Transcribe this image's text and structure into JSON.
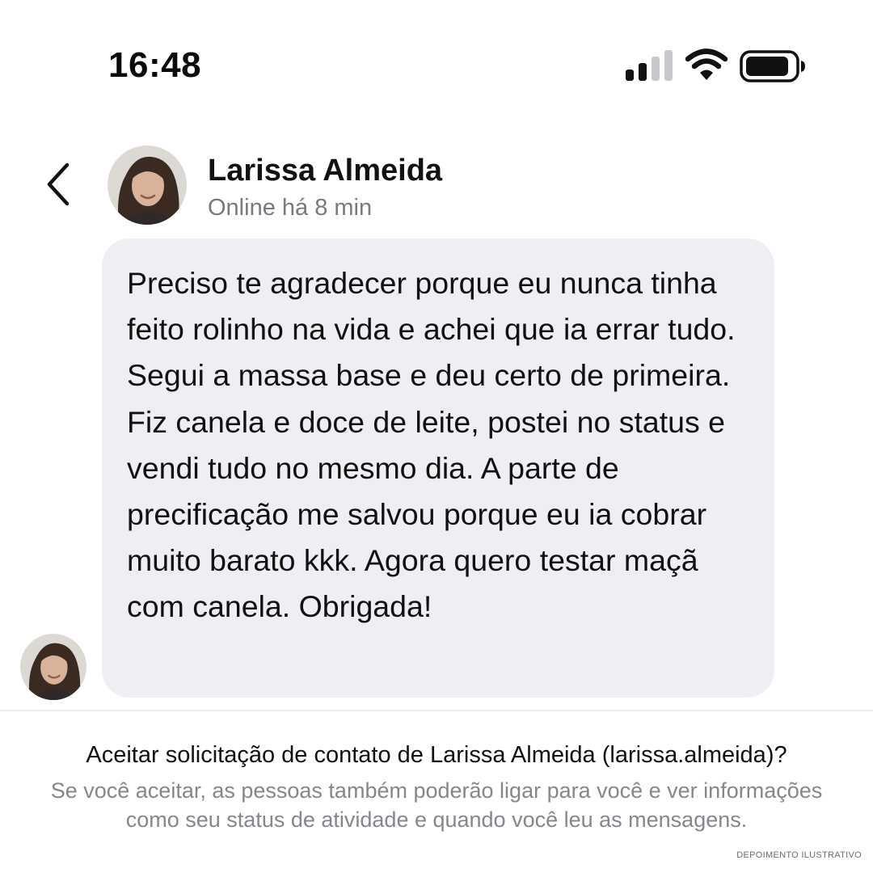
{
  "status_bar": {
    "time": "16:48",
    "signal_icon": "cellular-signal-icon",
    "wifi_icon": "wifi-icon",
    "battery_icon": "battery-icon"
  },
  "header": {
    "back_icon": "chevron-left-icon",
    "avatar_icon": "contact-avatar",
    "contact_name": "Larissa Almeida",
    "contact_status": "Online há 8 min"
  },
  "message": {
    "text": "Preciso te agradecer porque eu nunca tinha feito rolinho na vida e achei que ia errar tudo. Segui a massa base e deu certo de primeira. Fiz canela e doce de leite, postei no status e vendi tudo no mesmo dia. A parte de precificação me salvou porque eu ia cobrar muito barato kkk. Agora quero testar maçã com canela. Obrigada!",
    "bubble_color": "#eeeff3"
  },
  "request": {
    "title": "Aceitar solicitação de contato de Larissa Almeida (larissa.almeida)?",
    "description": "Se você aceitar, as pessoas também poderão ligar para você e ver informações como seu status de atividade e quando você leu as mensagens."
  },
  "footer_note": "DEPOIMENTO ILUSTRATIVO",
  "colors": {
    "background": "#ffffff",
    "primary_text": "#111111",
    "secondary_text": "#777a80"
  }
}
